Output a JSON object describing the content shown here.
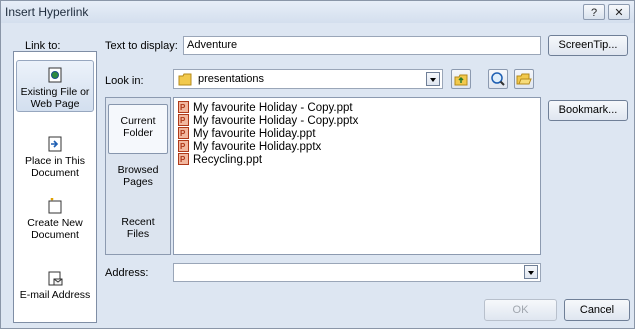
{
  "window": {
    "title": "Insert Hyperlink",
    "help_label": "?",
    "close_label": "✕"
  },
  "link_to": {
    "label": "Link to:",
    "items": [
      {
        "label_line1": "Existing File or",
        "label_line2": "Web Page",
        "icon": "web-page-icon",
        "selected": true
      },
      {
        "label_line1": "Place in This",
        "label_line2": "Document",
        "icon": "document-place-icon",
        "selected": false
      },
      {
        "label_line1": "Create New",
        "label_line2": "Document",
        "icon": "new-document-icon",
        "selected": false
      },
      {
        "label_line1": "E-mail Address",
        "label_line2": "",
        "icon": "email-icon",
        "selected": false
      }
    ]
  },
  "text_to_display": {
    "label": "Text to display:",
    "value": "Adventure"
  },
  "screentip_button": "ScreenTip...",
  "look_in": {
    "label": "Look in:",
    "value": "presentations",
    "folder_icon": "folder-icon"
  },
  "toolbar_icons": [
    "up-folder-icon",
    "browse-web-icon",
    "open-folder-icon"
  ],
  "nav": [
    {
      "label_line1": "Current",
      "label_line2": "Folder",
      "selected": true
    },
    {
      "label_line1": "Browsed",
      "label_line2": "Pages",
      "selected": false
    },
    {
      "label_line1": "Recent",
      "label_line2": "Files",
      "selected": false
    }
  ],
  "files": [
    {
      "name": "My favourite Holiday - Copy.ppt",
      "icon": "ppt-file-icon"
    },
    {
      "name": "My favourite Holiday - Copy.pptx",
      "icon": "pptx-file-icon"
    },
    {
      "name": "My favourite Holiday.ppt",
      "icon": "ppt-file-icon"
    },
    {
      "name": "My favourite Holiday.pptx",
      "icon": "pptx-file-icon"
    },
    {
      "name": "Recycling.ppt",
      "icon": "ppt-file-icon"
    }
  ],
  "bookmark_button": "Bookmark...",
  "address": {
    "label": "Address:",
    "value": ""
  },
  "ok_button": "OK",
  "cancel_button": "Cancel"
}
